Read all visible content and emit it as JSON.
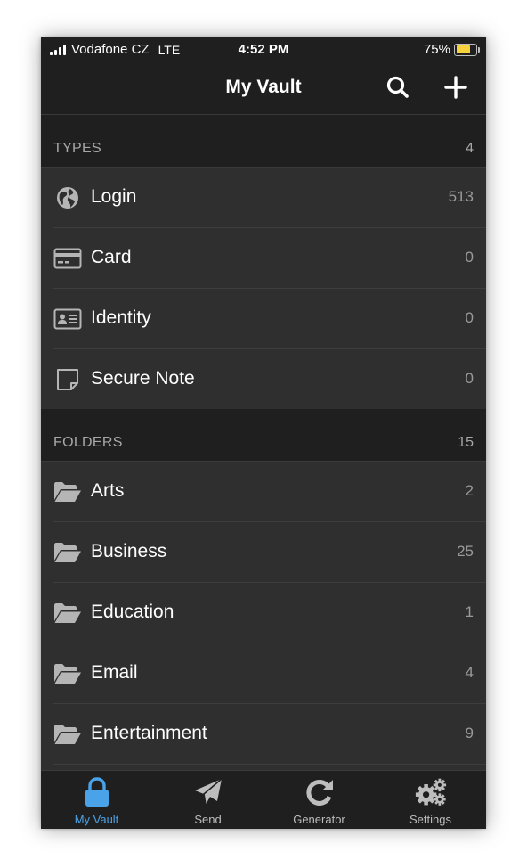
{
  "status_bar": {
    "carrier": "Vodafone CZ",
    "network": "LTE",
    "time": "4:52 PM",
    "battery_text": "75%",
    "battery_level": 0.75
  },
  "nav": {
    "title": "My Vault",
    "search_icon": "search-icon",
    "add_icon": "plus-icon"
  },
  "types": {
    "header": "TYPES",
    "count": "4",
    "items": [
      {
        "label": "Login",
        "count": "513",
        "icon": "globe-icon"
      },
      {
        "label": "Card",
        "count": "0",
        "icon": "credit-card-icon"
      },
      {
        "label": "Identity",
        "count": "0",
        "icon": "id-card-icon"
      },
      {
        "label": "Secure Note",
        "count": "0",
        "icon": "note-icon"
      }
    ]
  },
  "folders": {
    "header": "FOLDERS",
    "count": "15",
    "items": [
      {
        "label": "Arts",
        "count": "2",
        "icon": "folder-open-icon"
      },
      {
        "label": "Business",
        "count": "25",
        "icon": "folder-open-icon"
      },
      {
        "label": "Education",
        "count": "1",
        "icon": "folder-open-icon"
      },
      {
        "label": "Email",
        "count": "4",
        "icon": "folder-open-icon"
      },
      {
        "label": "Entertainment",
        "count": "9",
        "icon": "folder-open-icon"
      }
    ]
  },
  "tab_bar": {
    "tabs": [
      {
        "label": "My Vault",
        "icon": "lock-icon",
        "active": true
      },
      {
        "label": "Send",
        "icon": "paper-plane-icon",
        "active": false
      },
      {
        "label": "Generator",
        "icon": "refresh-icon",
        "active": false
      },
      {
        "label": "Settings",
        "icon": "gears-icon",
        "active": false
      }
    ]
  },
  "colors": {
    "background": "#2f2f2f",
    "header_background": "#1f1f1f",
    "accent": "#4aa3e8",
    "battery": "#f6d33c"
  }
}
